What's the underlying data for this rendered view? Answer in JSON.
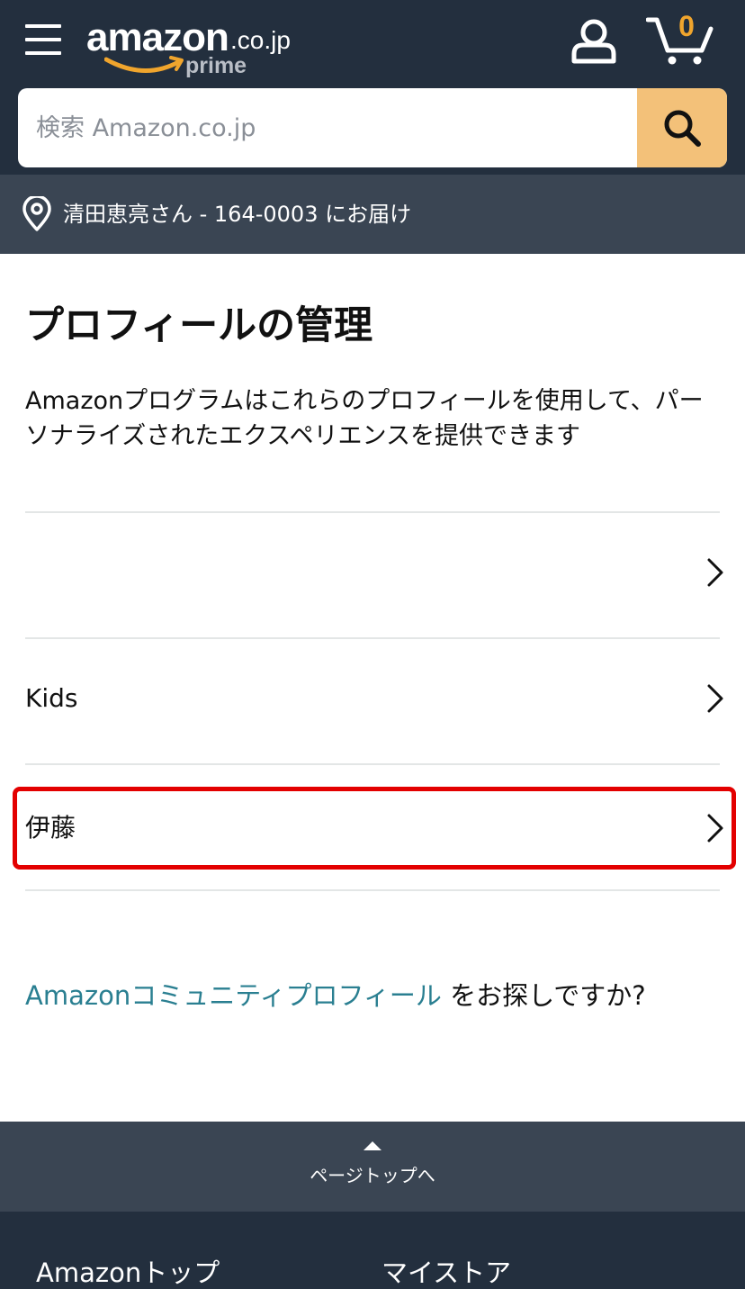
{
  "header": {
    "logo_word": "amazon",
    "logo_tld": ".co.jp",
    "logo_sub": "prime",
    "cart_count": "0",
    "accent_color": "#f0a52d",
    "icons": [
      "menu-icon",
      "account-icon",
      "cart-icon",
      "search-icon",
      "location-pin-icon"
    ]
  },
  "search": {
    "placeholder": "検索 Amazon.co.jp",
    "value": ""
  },
  "delivery": {
    "text": "清田恵亮さん - 164-0003 にお届け"
  },
  "main": {
    "title": "プロフィールの管理",
    "description": "Amazonプログラムはこれらのプロフィールを使用して、パーソナライズされたエクスペリエンスを提供できます",
    "profiles": [
      {
        "name": ""
      },
      {
        "name": "Kids"
      },
      {
        "name": "伊藤",
        "highlighted": true
      }
    ],
    "highlight_color": "#e30000",
    "community_link": "Amazonコミュニティプロフィール",
    "community_suffix": " をお探しですか?"
  },
  "back_to_top": {
    "label": "ページトップへ"
  },
  "footer": {
    "links": [
      "Amazonトップ",
      "マイストア"
    ]
  }
}
